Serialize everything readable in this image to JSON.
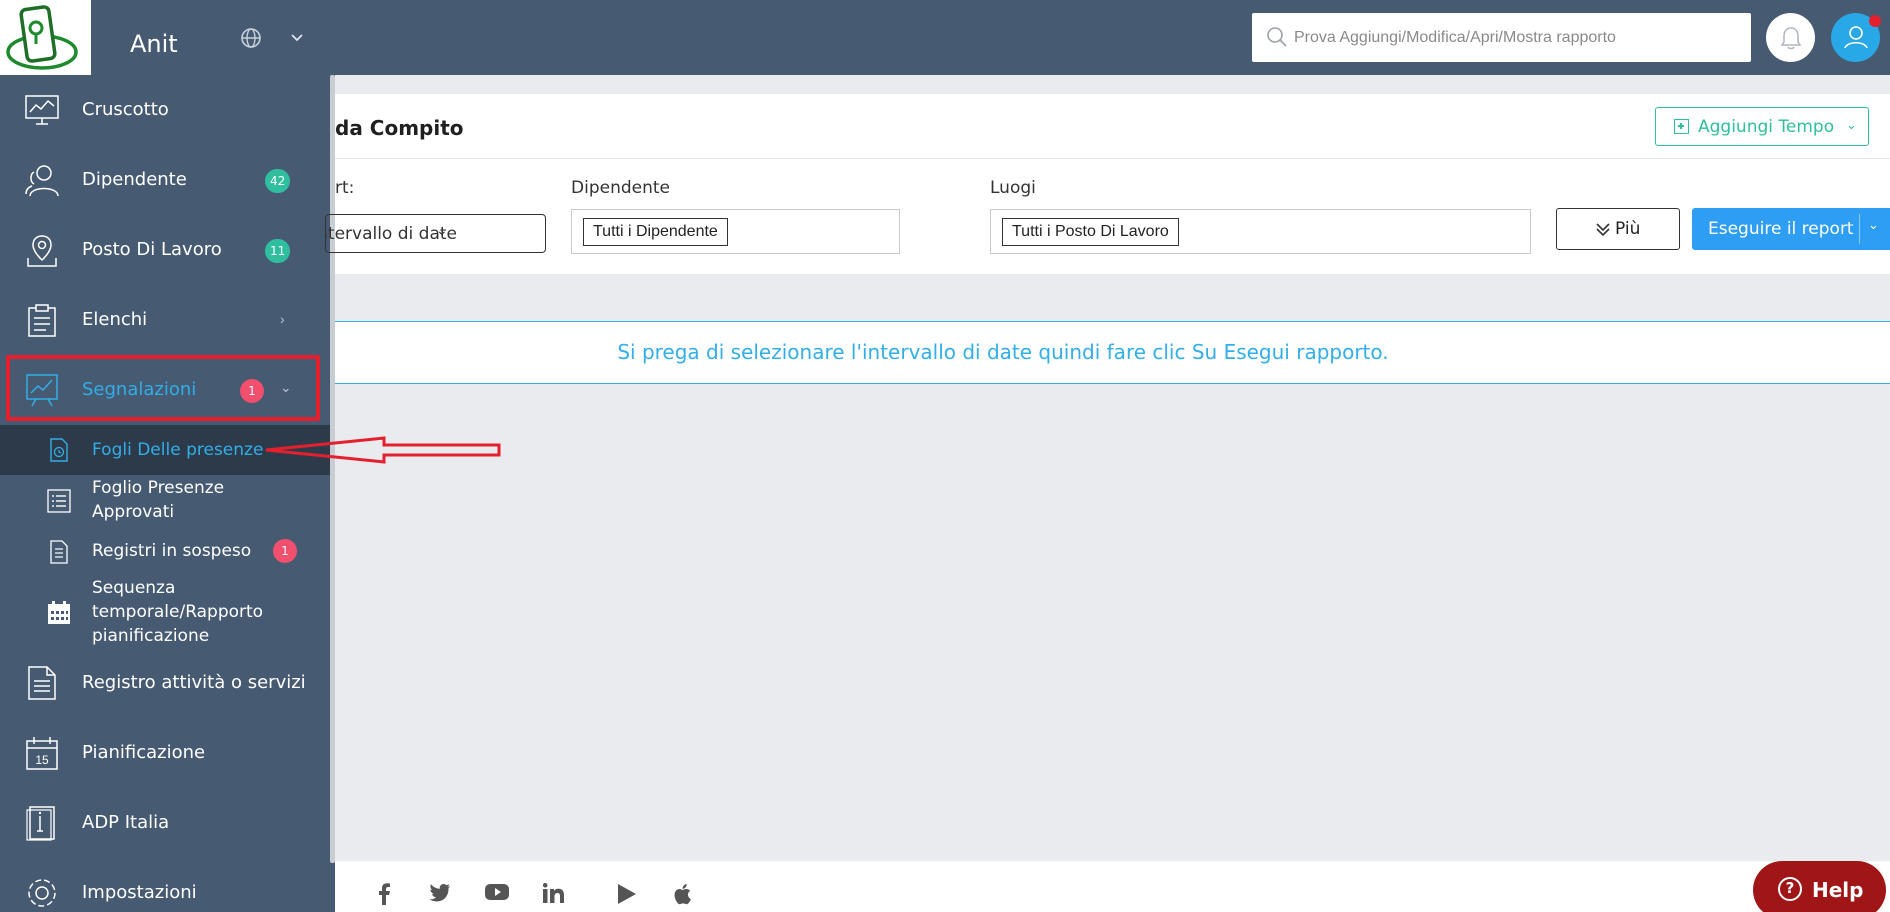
{
  "header": {
    "app_name": "Anit",
    "search_placeholder": "Prova Aggiungi/Modifica/Apri/Mostra rapporto"
  },
  "sidebar": {
    "items": [
      {
        "label": "Cruscotto",
        "icon": "dashboard-monitor-icon"
      },
      {
        "label": "Dipendente",
        "icon": "users-icon",
        "badge": "42"
      },
      {
        "label": "Posto Di Lavoro",
        "icon": "map-pin-icon",
        "badge": "11"
      },
      {
        "label": "Elenchi",
        "icon": "clipboard-list-icon"
      },
      {
        "label": "Segnalazioni",
        "icon": "report-chart-icon",
        "badge": "1"
      },
      {
        "label": "Registro attività o servizi",
        "icon": "document-icon"
      },
      {
        "label": "Pianificazione",
        "icon": "calendar-icon"
      },
      {
        "label": "ADP Italia",
        "icon": "adp-book-icon"
      },
      {
        "label": "Impostazioni",
        "icon": "gear-icon"
      }
    ],
    "subitems": [
      {
        "label": "Fogli Delle presenze",
        "icon": "timesheet-icon"
      },
      {
        "label_line1": "Foglio Presenze",
        "label_line2": "Approvati",
        "icon": "list-icon"
      },
      {
        "label": "Registri in sospeso",
        "icon": "pending-doc-icon",
        "badge": "1"
      },
      {
        "label_line1": "Sequenza",
        "label_line2": "temporale/Rapporto",
        "label_line3": "pianificazione",
        "icon": "calendar-grid-icon"
      }
    ]
  },
  "main": {
    "title": "da Compito",
    "add_time_label": "Aggiungi Tempo",
    "filters": {
      "report_label": "rt:",
      "date_value": "Intervallo di date",
      "employee_label": "Dipendente",
      "employee_chip": "Tutti i Dipendente",
      "locations_label": "Luogi",
      "locations_chip": "Tutti i Posto Di Lavoro"
    },
    "more_label": "Più",
    "run_label": "Eseguire il report",
    "notice": "Si prega di selezionare l'intervallo di date quindi fare clic Su Esegui rapporto."
  },
  "help_label": "Help",
  "colors": {
    "sidebar_bg": "#465a72",
    "accent_blue": "#32aee8",
    "accent_green": "#2fbf9e",
    "badge_red": "#f0506e",
    "run_button": "#2e9ef5",
    "help_button": "#a01515"
  }
}
